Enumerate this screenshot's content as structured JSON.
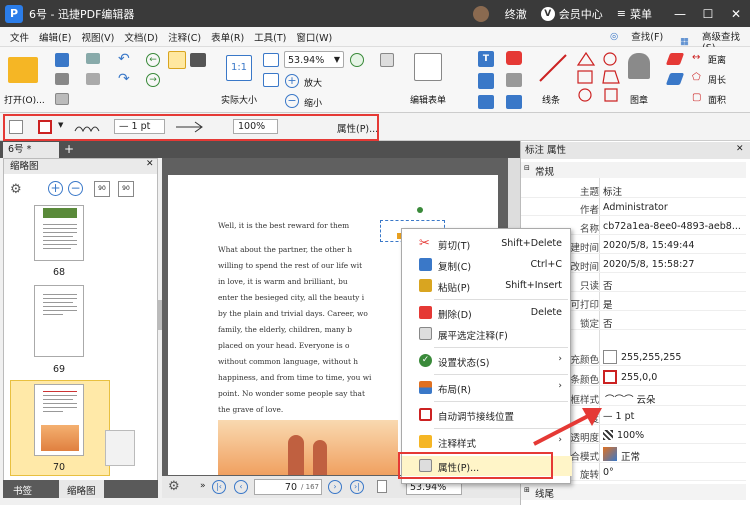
{
  "app": {
    "title": "6号 - 迅捷PDF编辑器",
    "logo": "P",
    "user": "终澈",
    "member_center": "会员中心",
    "member_icon": "V",
    "menu_label": "菜单"
  },
  "menu": [
    "文件",
    "编辑(E)",
    "视图(V)",
    "文档(D)",
    "注释(C)",
    "表单(R)",
    "工具(T)",
    "窗口(W)"
  ],
  "menu_right": {
    "find": "查找(F)",
    "advanced_find": "高级查找(S)"
  },
  "ribbon": {
    "open": "打开(O)...",
    "actual_size": "实际大小",
    "zoom": "53.94%",
    "zoom_in": "放大",
    "zoom_out": "缩小",
    "edit_form": "编辑表单",
    "line": "线条",
    "shapes": "图章",
    "distance": "距离",
    "perimeter": "周长",
    "area": "面积"
  },
  "propbar": {
    "line_width": "1 pt",
    "opacity": "100%",
    "properties": "属性(P)..."
  },
  "tabs": {
    "doc_tab": "6号 *"
  },
  "thumbnails": {
    "title": "缩略图",
    "pages": [
      "68",
      "69",
      "70"
    ],
    "bottom_tabs": [
      "书签",
      "缩略图"
    ]
  },
  "document": {
    "lines": [
      "Well, it is the best reward for them",
      "What  about  the  partner,  the  other  h",
      "willing to spend the rest of our life wit",
      "in  love,  it  is  warm and brilliant,  bu",
      "enter the besieged city, all the beauty i",
      "by the plain and trivial days. Career, wo",
      "family,  the  elderly,  children,  many  b",
      "placed  on  your  head.  Everyone  is  o",
      "without   common   language,   without   h",
      "happiness, and from time to time, you wi",
      "point. No wonder some people say that",
      "the grave of love."
    ]
  },
  "nav": {
    "page": "70",
    "total": "/ 167",
    "zoom": "53.94%"
  },
  "context_menu": [
    {
      "label": "剪切(T)",
      "shortcut": "Shift+Delete",
      "icon": "scissors-icon"
    },
    {
      "label": "复制(C)",
      "shortcut": "Ctrl+C",
      "icon": "copy-icon"
    },
    {
      "label": "粘贴(P)",
      "shortcut": "Shift+Insert",
      "icon": "paste-icon"
    },
    {
      "label": "删除(D)",
      "shortcut": "Delete",
      "icon": "trash-icon"
    },
    {
      "label": "展平选定注释(F)",
      "shortcut": "",
      "icon": "flatten-icon"
    },
    {
      "label": "设置状态(S)",
      "shortcut": "",
      "icon": "status-icon",
      "submenu": true
    },
    {
      "label": "布局(R)",
      "shortcut": "",
      "icon": "layout-icon",
      "submenu": true
    },
    {
      "label": "自动调节接线位置",
      "shortcut": "",
      "icon": "connector-icon"
    },
    {
      "label": "注释样式",
      "shortcut": "",
      "icon": "style-icon",
      "submenu": true
    },
    {
      "label": "属性(P)...",
      "shortcut": "",
      "icon": "properties-icon"
    }
  ],
  "properties": {
    "title": "标注 属性",
    "section_general": "常规",
    "section_line": "线尾",
    "rows": [
      {
        "key": "主题",
        "value": "标注"
      },
      {
        "key": "作者",
        "value": "Administrator"
      },
      {
        "key": "名称",
        "value": "cb72a1ea-8ee0-4893-aeb8..."
      },
      {
        "key": "建时间",
        "value": "2020/5/8, 15:49:44"
      },
      {
        "key": "改时间",
        "value": "2020/5/8, 15:58:27"
      },
      {
        "key": "只读",
        "value": "否"
      },
      {
        "key": "可打印",
        "value": "是"
      },
      {
        "key": "锁定",
        "value": "否"
      },
      {
        "key": "充颜色",
        "value": "255,255,255"
      },
      {
        "key": "条颜色",
        "value": "255,0,0"
      },
      {
        "key": "框样式",
        "value": "云朵"
      },
      {
        "key": "度",
        "value": "1 pt"
      },
      {
        "key": "透明度",
        "value": "100%"
      },
      {
        "key": "合模式",
        "value": "正常"
      },
      {
        "key": "旋转",
        "value": "0°"
      }
    ]
  },
  "colors": {
    "accent": "#2b7de9",
    "highlight": "#e53935",
    "stroke": "#cc2222"
  }
}
